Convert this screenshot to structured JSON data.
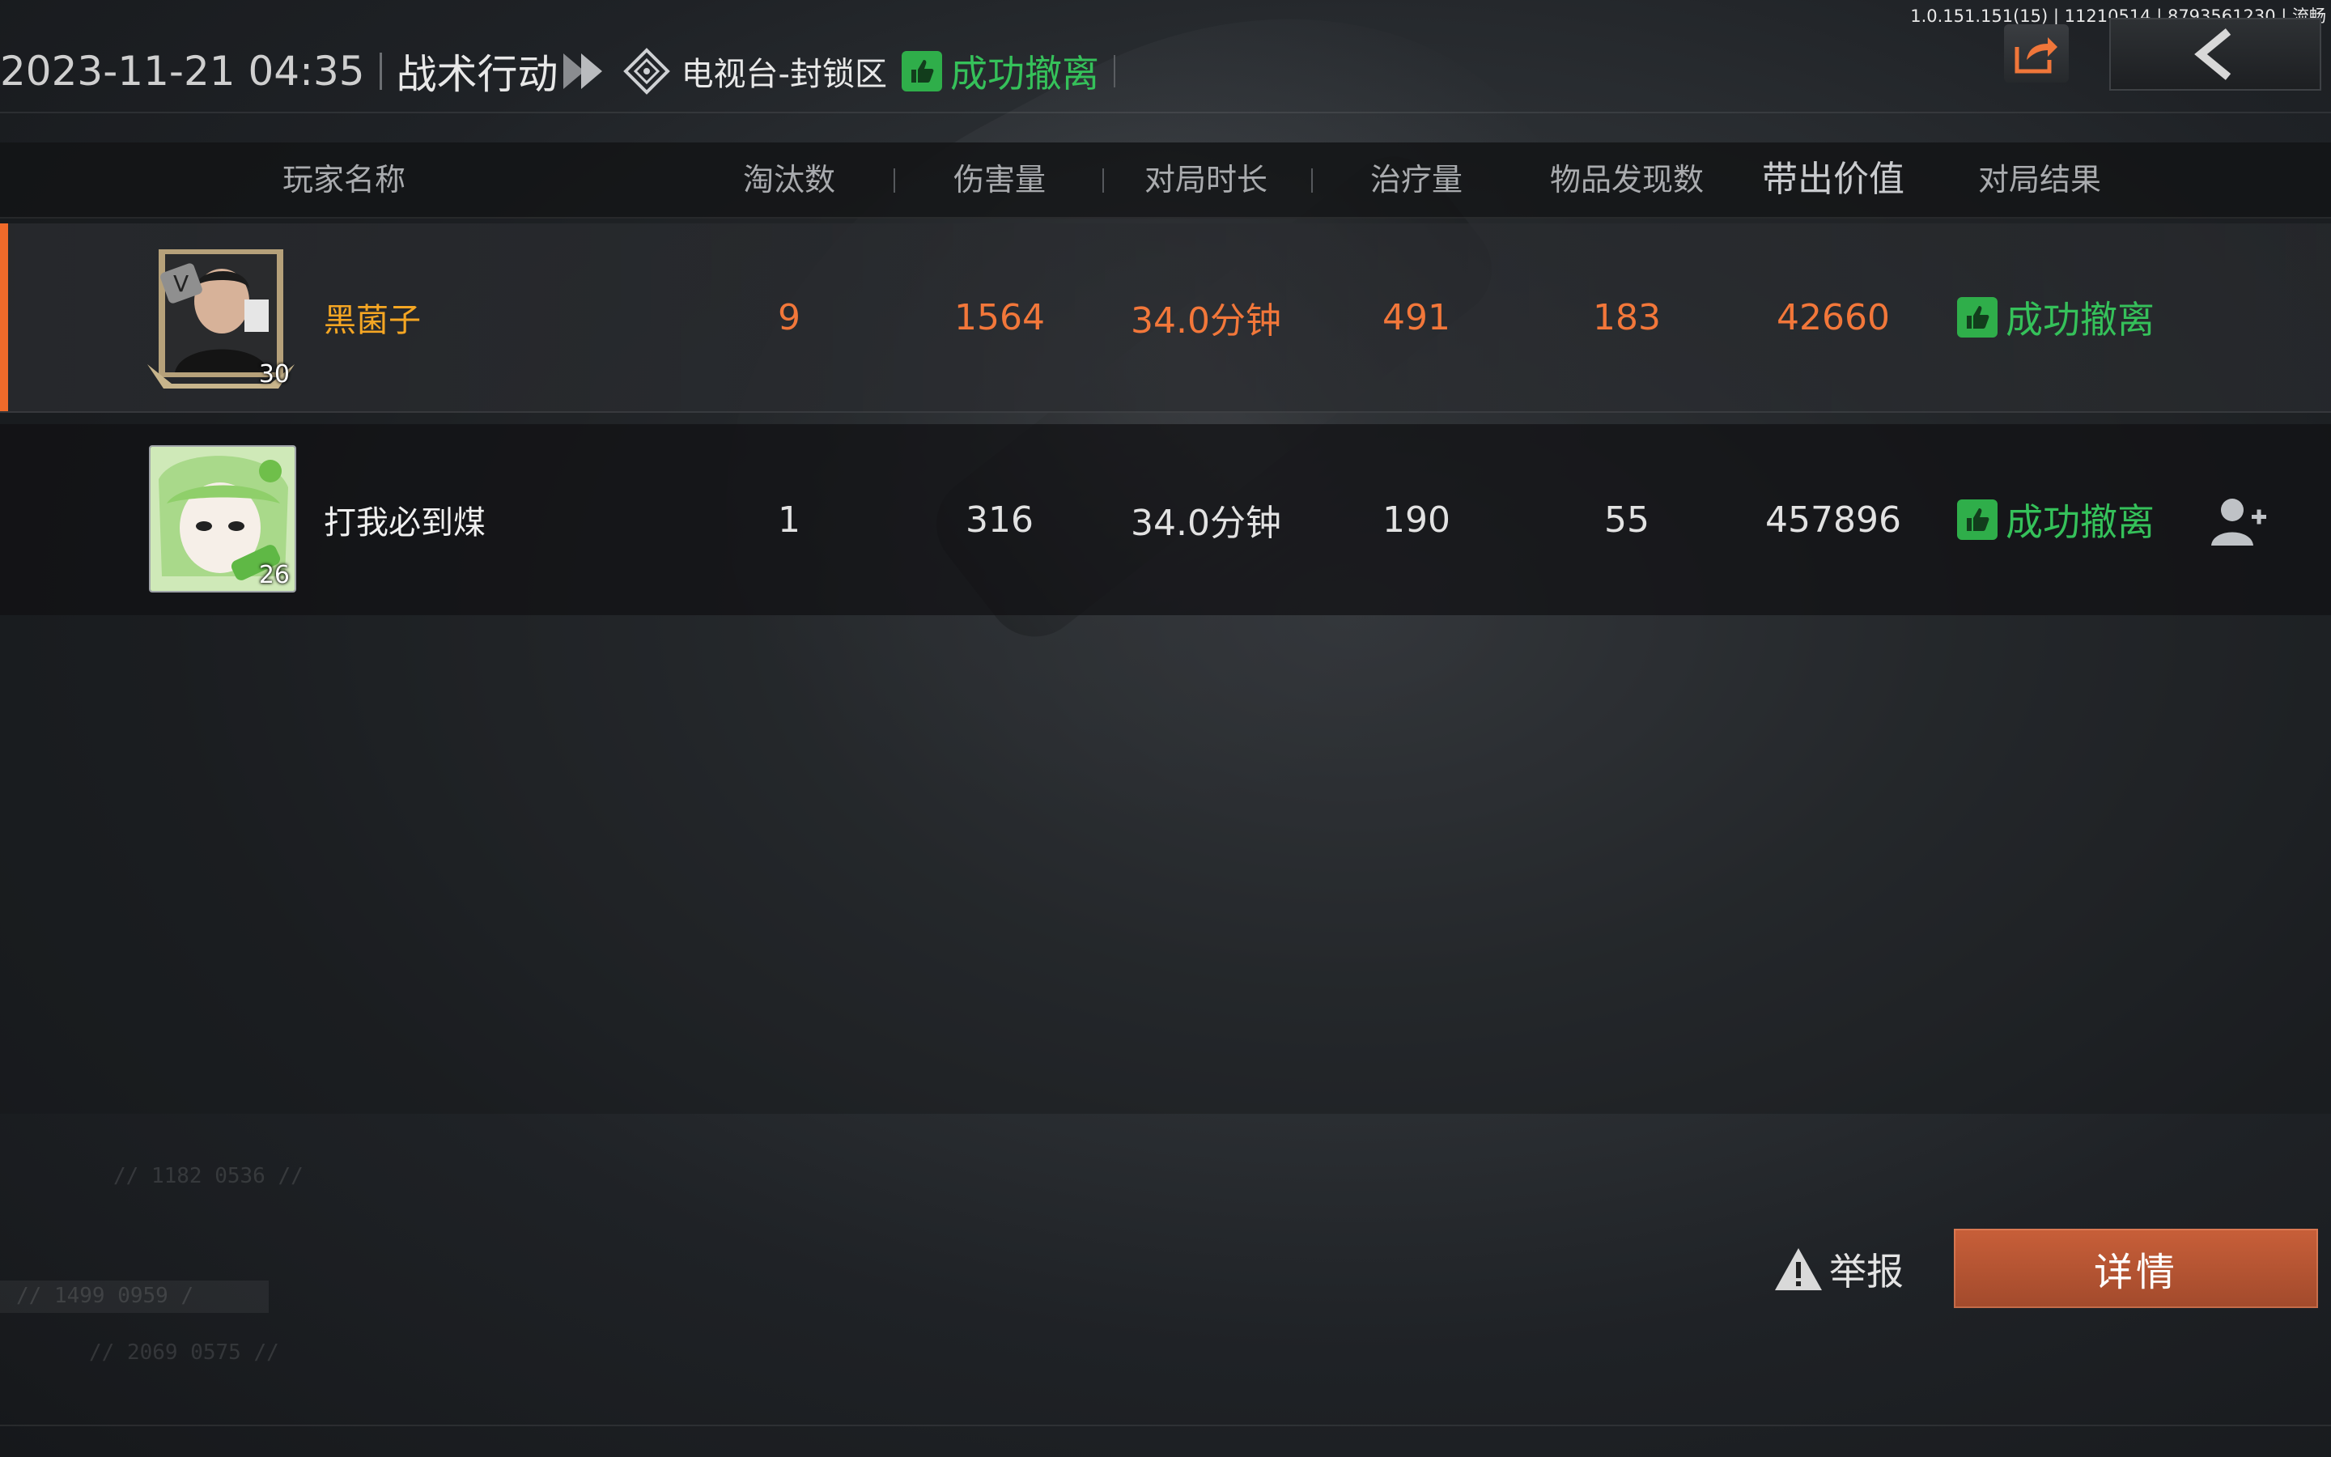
{
  "build_info": "1.0.151.151(15) | 11210514 | 8793561230 | 流畅",
  "header": {
    "datetime": "2023-11-21 04:35",
    "mode": "战术行动",
    "map": "电视台-封锁区",
    "result": "成功撤离"
  },
  "columns": [
    "玩家名称",
    "淘汰数",
    "伤害量",
    "对局时长",
    "治疗量",
    "物品发现数",
    "带出价值",
    "对局结果"
  ],
  "players": [
    {
      "name": "黑菌子",
      "level": "30",
      "eliminations": "9",
      "damage": "1564",
      "duration": "34.0分钟",
      "healing": "491",
      "items_found": "183",
      "extracted_value": "42660",
      "result": "成功撤离"
    },
    {
      "name": "打我必到煤",
      "level": "26",
      "eliminations": "1",
      "damage": "316",
      "duration": "34.0分钟",
      "healing": "190",
      "items_found": "55",
      "extracted_value": "457896",
      "result": "成功撤离"
    }
  ],
  "faint_text": {
    "line1": "// 1182 0536 //",
    "line2": "// 1499 0959 /",
    "line3": "// 2069 0575 //"
  },
  "actions": {
    "report": "举报",
    "details": "详情"
  },
  "colors": {
    "accent_orange": "#f06a2a",
    "success_green": "#35c15a",
    "self_name": "#f5a623",
    "details_button": "#b8552f"
  }
}
